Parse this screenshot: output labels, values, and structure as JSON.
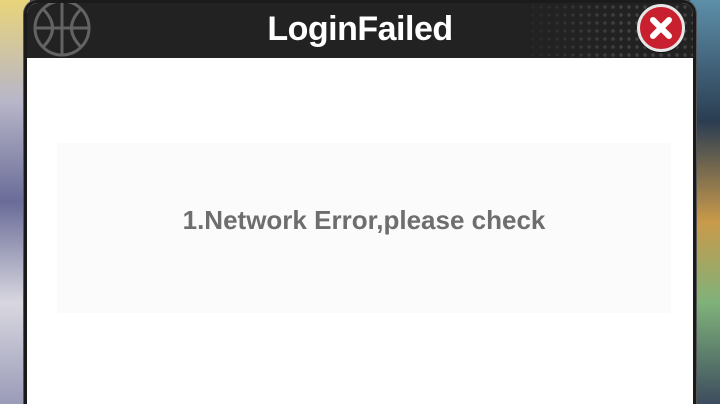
{
  "dialog": {
    "title": "LoginFailed",
    "message": "1.Network Error,please check",
    "close_icon": "close-icon",
    "title_icon": "basketball-icon"
  },
  "colors": {
    "titlebar": "#222222",
    "close_button": "#c8202e",
    "message_text": "#6e6e6e",
    "dialog_background": "#ffffff"
  }
}
